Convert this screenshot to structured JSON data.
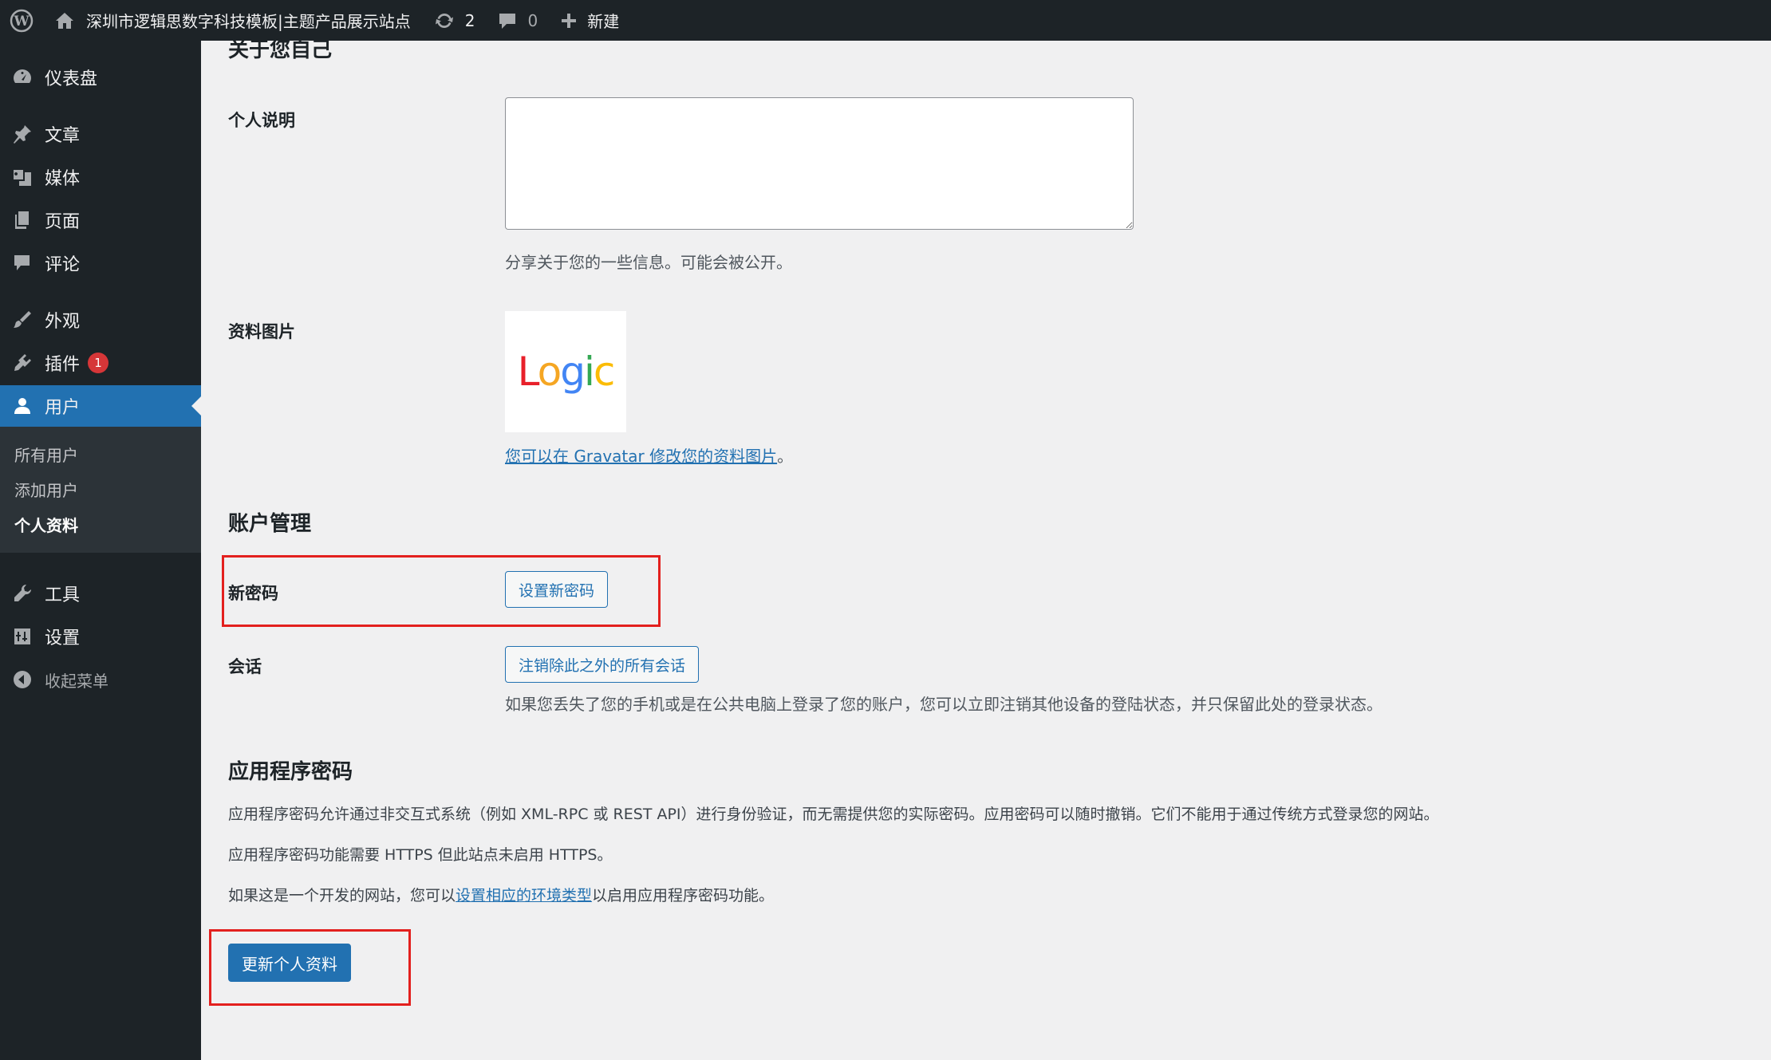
{
  "adminbar": {
    "site_name": "深圳市逻辑思数字科技模板|主题产品展示站点",
    "updates_count": "2",
    "comments_count": "0",
    "new_label": "新建"
  },
  "sidebar": {
    "items": [
      {
        "label": "仪表盘",
        "icon": "dashboard-icon"
      },
      {
        "label": "文章",
        "icon": "pin-icon"
      },
      {
        "label": "媒体",
        "icon": "media-icon"
      },
      {
        "label": "页面",
        "icon": "page-icon"
      },
      {
        "label": "评论",
        "icon": "comment-icon"
      },
      {
        "label": "外观",
        "icon": "brush-icon"
      },
      {
        "label": "插件",
        "icon": "plugin-icon",
        "badge": "1"
      },
      {
        "label": "用户",
        "icon": "user-icon"
      },
      {
        "label": "工具",
        "icon": "wrench-icon"
      },
      {
        "label": "设置",
        "icon": "settings-icon"
      }
    ],
    "collapse_label": "收起菜单",
    "submenu": [
      {
        "label": "所有用户"
      },
      {
        "label": "添加用户"
      },
      {
        "label": "个人资料"
      }
    ]
  },
  "about": {
    "heading": "关于您自己",
    "bio_label": "个人说明",
    "bio_value": "",
    "bio_desc": "分享关于您的一些信息。可能会被公开。",
    "picture_label": "资料图片",
    "avatar_text": "Logic",
    "gravatar_link": "您可以在 Gravatar 修改您的资料图片",
    "gravatar_suffix": "。"
  },
  "account": {
    "heading": "账户管理",
    "password_label": "新密码",
    "password_button": "设置新密码",
    "sessions_label": "会话",
    "sessions_button": "注销除此之外的所有会话",
    "sessions_desc": "如果您丢失了您的手机或是在公共电脑上登录了您的账户，您可以立即注销其他设备的登陆状态，并只保留此处的登录状态。"
  },
  "app_passwords": {
    "heading": "应用程序密码",
    "para1": "应用程序密码允许通过非交互式系统（例如 XML-RPC 或 REST API）进行身份验证，而无需提供您的实际密码。应用密码可以随时撤销。它们不能用于通过传统方式登录您的网站。",
    "para2": "应用程序密码功能需要 HTTPS 但此站点未启用 HTTPS。",
    "para3_prefix": "如果这是一个开发的网站，您可以",
    "para3_link": "设置相应的环境类型",
    "para3_suffix": "以启用应用程序密码功能。"
  },
  "submit_button": "更新个人资料",
  "colors": {
    "admin_dark": "#1d2327",
    "accent": "#2271b1",
    "highlight_red": "#e3201e"
  }
}
